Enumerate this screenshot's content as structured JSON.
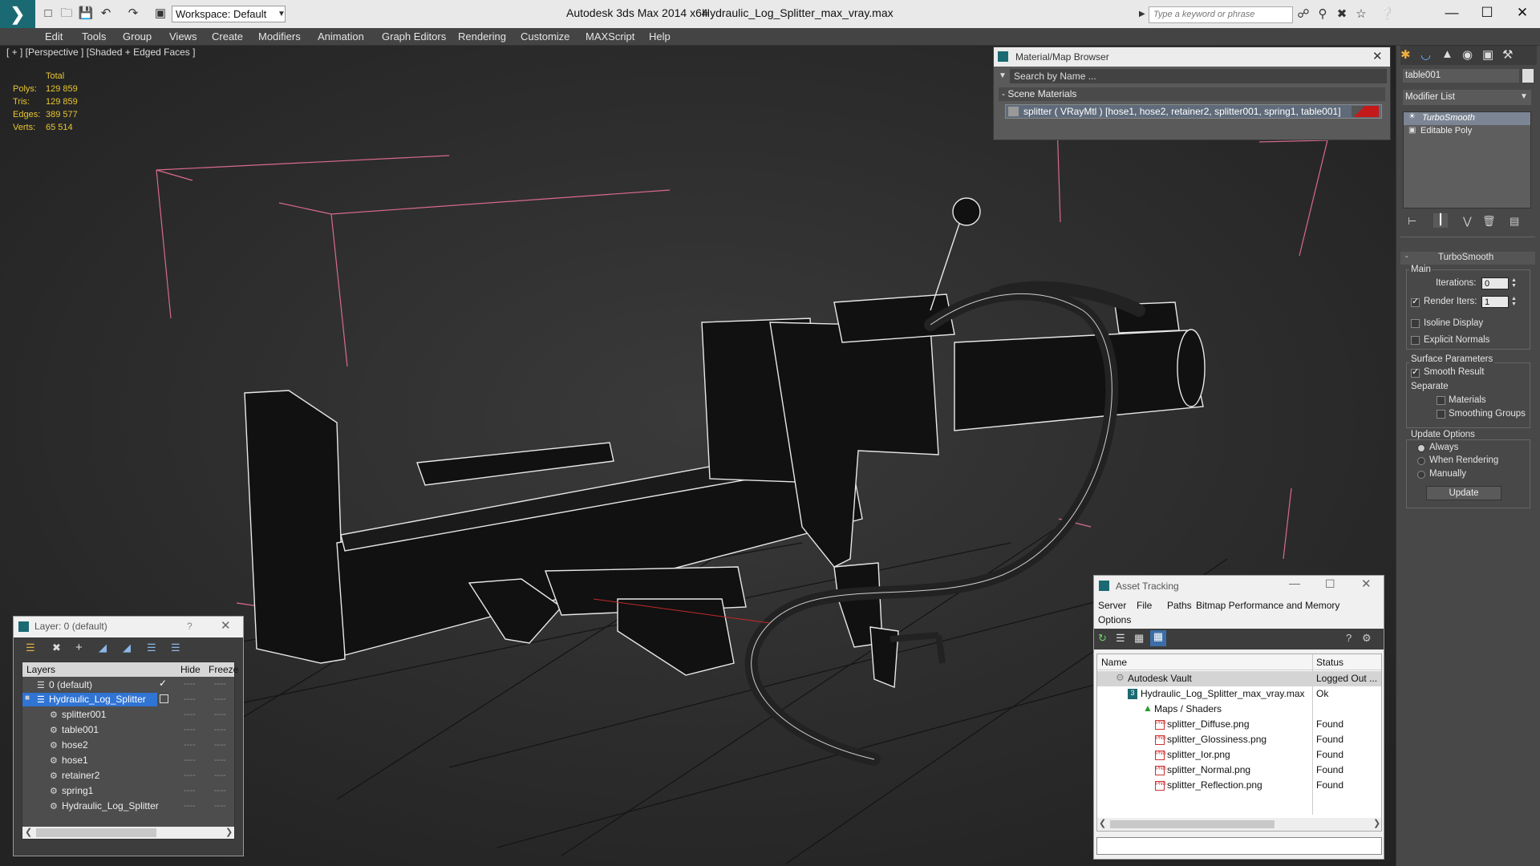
{
  "titlebar": {
    "workspace": "Workspace: Default",
    "app_title": "Autodesk 3ds Max  2014 x64",
    "file_title": "Hydraulic_Log_Splitter_max_vray.max",
    "search_placeholder": "Type a keyword or phrase"
  },
  "menu": [
    "Edit",
    "Tools",
    "Group",
    "Views",
    "Create",
    "Modifiers",
    "Animation",
    "Graph Editors",
    "Rendering",
    "Customize",
    "MAXScript",
    "Help"
  ],
  "viewport": {
    "label": "[ + ] [Perspective ] [Shaded + Edged Faces ]",
    "stats": {
      "header": "Total",
      "rows": [
        {
          "k": "Polys:",
          "v": "129 859"
        },
        {
          "k": "Tris:",
          "v": "129 859"
        },
        {
          "k": "Edges:",
          "v": "389 577"
        },
        {
          "k": "Verts:",
          "v": "65 514"
        }
      ]
    }
  },
  "material_browser": {
    "title": "Material/Map Browser",
    "search": "Search by Name ...",
    "section": "- Scene Materials",
    "material": "splitter  ( VRayMtl ) [hose1, hose2, retainer2, splitter001, spring1, table001]"
  },
  "command_panel": {
    "object_name": "table001",
    "modifier_list": "Modifier List",
    "stack": [
      "TurboSmooth",
      "Editable Poly"
    ],
    "rollout": "TurboSmooth",
    "main": "Main",
    "iterations_label": "Iterations:",
    "iterations": "0",
    "render_iters_label": "Render Iters:",
    "render_iters": "1",
    "isoline": "Isoline Display",
    "explicit": "Explicit Normals",
    "surface": "Surface Parameters",
    "smooth": "Smooth Result",
    "separate": "Separate",
    "materials": "Materials",
    "smoothing": "Smoothing Groups",
    "update_options": "Update Options",
    "always": "Always",
    "when_rendering": "When Rendering",
    "manually": "Manually",
    "update": "Update"
  },
  "asset_tracking": {
    "title": "Asset Tracking",
    "menu": [
      "Server",
      "File",
      "Paths",
      "Bitmap Performance and Memory",
      "Options"
    ],
    "col_name": "Name",
    "col_status": "Status",
    "rows": [
      {
        "name": "Autodesk Vault",
        "status": "Logged Out ..."
      },
      {
        "name": "Hydraulic_Log_Splitter_max_vray.max",
        "status": "Ok"
      },
      {
        "name": "Maps / Shaders",
        "status": ""
      },
      {
        "name": "splitter_Diffuse.png",
        "status": "Found"
      },
      {
        "name": "splitter_Glossiness.png",
        "status": "Found"
      },
      {
        "name": "splitter_Ior.png",
        "status": "Found"
      },
      {
        "name": "splitter_Normal.png",
        "status": "Found"
      },
      {
        "name": "splitter_Reflection.png",
        "status": "Found"
      }
    ]
  },
  "layer_window": {
    "title": "Layer: 0 (default)",
    "help": "?",
    "col_layers": "Layers",
    "col_hide": "Hide",
    "col_freeze": "Freeze",
    "rows": [
      "0 (default)",
      "Hydraulic_Log_Splitter",
      "splitter001",
      "table001",
      "hose2",
      "hose1",
      "retainer2",
      "spring1",
      "Hydraulic_Log_Splitter"
    ]
  }
}
